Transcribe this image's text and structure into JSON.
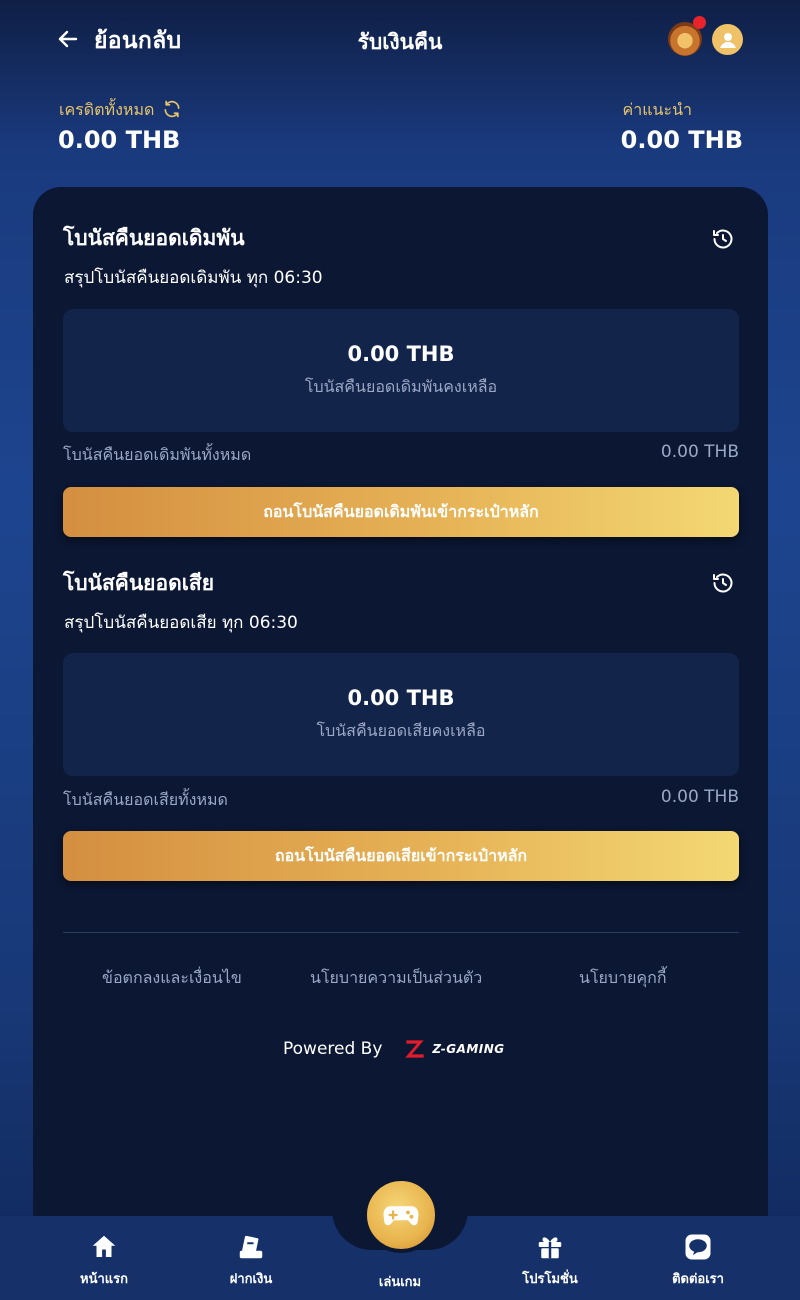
{
  "header": {
    "back_label": "ย้อนกลับ",
    "title": "รับเงินคืน",
    "notification_color": "#e8232c"
  },
  "balances": {
    "credit_label": "เครดิตทั้งหมด",
    "credit_value": "0.00 THB",
    "referral_label": "ค่าแนะนำ",
    "referral_value": "0.00 THB"
  },
  "turnover_bonus": {
    "title": "โบนัสคืนยอดเดิมพัน",
    "subtitle": "สรุปโบนัสคืนยอดเดิมพัน ทุก 06:30",
    "remaining_amount": "0.00 THB",
    "remaining_label": "โบนัสคืนยอดเดิมพันคงเหลือ",
    "total_label": "โบนัสคืนยอดเดิมพันทั้งหมด",
    "total_value": "0.00 THB",
    "button_label": "ถอนโบนัสคืนยอดเดิมพันเข้ากระเป๋าหลัก"
  },
  "loss_bonus": {
    "title": "โบนัสคืนยอดเสีย",
    "subtitle": "สรุปโบนัสคืนยอดเสีย ทุก 06:30",
    "remaining_amount": "0.00 THB",
    "remaining_label": "โบนัสคืนยอดเสียคงเหลือ",
    "total_label": "โบนัสคืนยอดเสียทั้งหมด",
    "total_value": "0.00 THB",
    "button_label": "ถอนโบนัสคืนยอดเสียเข้ากระเป๋าหลัก"
  },
  "footer": {
    "links": [
      "ข้อตกลงและเงื่อนไข",
      "นโยบายความเป็นส่วนตัว",
      "นโยบายคุกกี้"
    ],
    "powered_by": "Powered By",
    "brand": "Z-GAMING"
  },
  "bottom_nav": {
    "items": [
      {
        "label": "หน้าแรก",
        "icon": "home-icon"
      },
      {
        "label": "ฝากเงิน",
        "icon": "deposit-icon"
      },
      {
        "label": "เล่นเกม",
        "icon": "gamepad-icon"
      },
      {
        "label": "โปรโมชั่น",
        "icon": "gift-icon"
      },
      {
        "label": "ติดต่อเรา",
        "icon": "line-chat-icon"
      }
    ]
  },
  "colors": {
    "accent_gold": "#e7c46a",
    "button_gradient_start": "#d48f40",
    "button_gradient_end": "#f3d873",
    "panel_bg": "#0b1733",
    "nav_bg": "#16306a"
  }
}
